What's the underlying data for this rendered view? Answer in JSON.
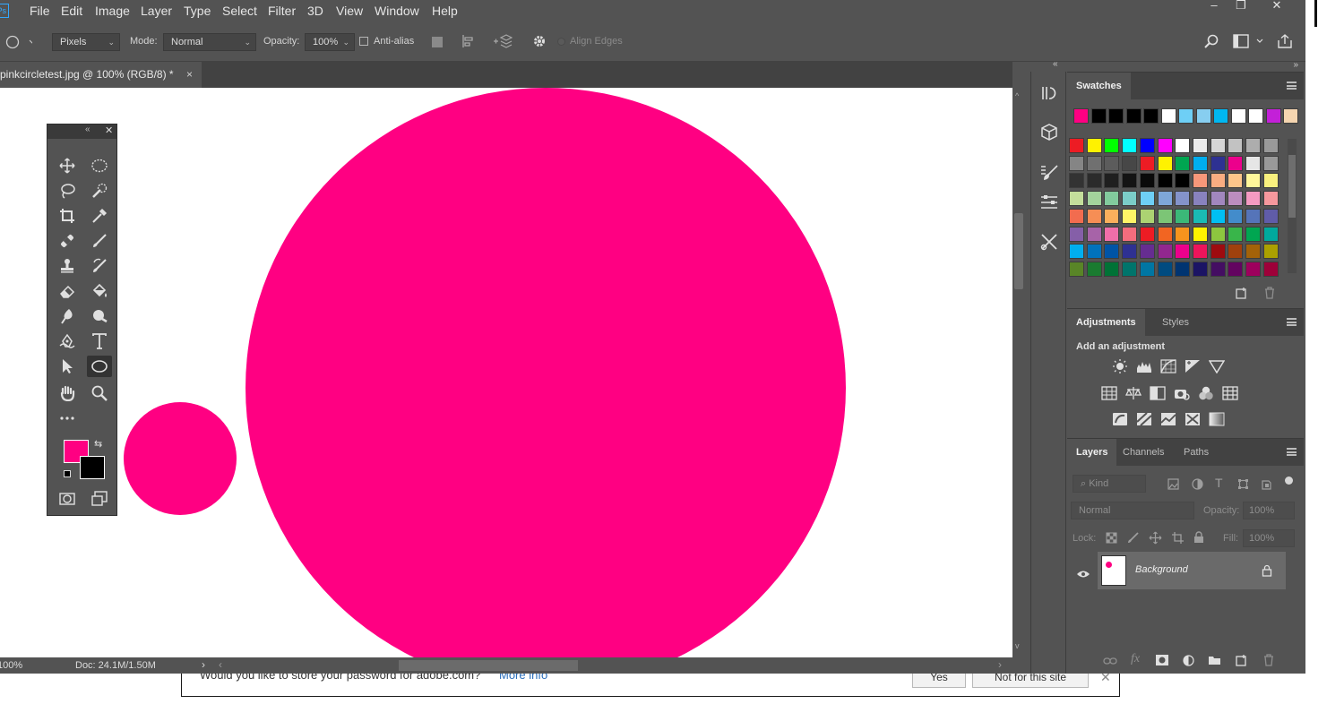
{
  "app": {
    "logo": "Ps"
  },
  "menu": [
    "File",
    "Edit",
    "Image",
    "Layer",
    "Type",
    "Select",
    "Filter",
    "3D",
    "View",
    "Window",
    "Help"
  ],
  "window_controls": [
    "–",
    "❐",
    "✕"
  ],
  "options": {
    "tool_mode": "Pixels",
    "mode_label": "Mode:",
    "mode_value": "Normal",
    "opacity_label": "Opacity:",
    "opacity_value": "100%",
    "antialias_label": "Anti-alias",
    "align_edges_label": "Align Edges"
  },
  "document": {
    "tab_title": "pinkcircletest.jpg @ 100% (RGB/8) *",
    "tab_close": "×",
    "zoom": "100%",
    "doc_info": "Doc: 24.1M/1.50M",
    "circle_color": "#ff0082",
    "foreground_color": "#ff0082",
    "background_color": "#000000"
  },
  "panels": {
    "swatches_tab": "Swatches",
    "adjustments_tab": "Adjustments",
    "styles_tab": "Styles",
    "adjustments_heading": "Add an adjustment",
    "layers_tab": "Layers",
    "channels_tab": "Channels",
    "paths_tab": "Paths",
    "kind_filter": "Kind",
    "blend_mode": "Normal",
    "opacity_label": "Opacity:",
    "opacity_value": "100%",
    "lock_label": "Lock:",
    "fill_label": "Fill:",
    "fill_value": "100%",
    "layer_name": "Background"
  },
  "swatches": {
    "recent": [
      "#ff0082",
      "#000000",
      "#000000",
      "#000000",
      "#000000",
      "#ffffff",
      "#6ecff6",
      "#87cef0",
      "#00b7f1",
      "#ffffff",
      "#ffffff",
      "#c320d8",
      "#f5d5b0"
    ],
    "grid": [
      [
        "#ed1c24",
        "#fff200",
        "#00ff00",
        "#00ffff",
        "#0000ff",
        "#ff00ff",
        "#ffffff",
        "#ebebeb",
        "#d6d6d6",
        "#c2c2c2",
        "#adadad",
        "#999999"
      ],
      [
        "#858585",
        "#707070",
        "#5c5c5c",
        "#474747",
        "#ed1c24",
        "#fff200",
        "#00a651",
        "#00aeef",
        "#2e3192",
        "#ec008c",
        "#e6e6e6",
        "#999999"
      ],
      [
        "#333333",
        "#2b2b2b",
        "#1f1f1f",
        "#141414",
        "#0a0a0a",
        "#000000",
        "#000000",
        "#f7977a",
        "#f9ad81",
        "#fdc68a",
        "#fff79a",
        "#f9f07e"
      ],
      [
        "#c4df9b",
        "#a3d39c",
        "#82ca9d",
        "#7bcdc8",
        "#6ecff6",
        "#7ea7d8",
        "#8493ca",
        "#8882be",
        "#a187be",
        "#bc8dbf",
        "#f49ac2",
        "#f6989d"
      ],
      [
        "#f26c4f",
        "#f68e55",
        "#fbaf5c",
        "#fff467",
        "#acd372",
        "#7cc576",
        "#3bb878",
        "#1abbb4",
        "#00bff3",
        "#438ccb",
        "#5574b9",
        "#605ca8"
      ],
      [
        "#855fa8",
        "#a763a8",
        "#f06ea9",
        "#f26d7d",
        "#ed1c24",
        "#f26522",
        "#f7941d",
        "#fff200",
        "#8dc63f",
        "#39b54a",
        "#00a651",
        "#00a99d"
      ],
      [
        "#00aeef",
        "#0072bc",
        "#0054a6",
        "#2e3192",
        "#662d91",
        "#92278f",
        "#ec008c",
        "#ed145b",
        "#9e0b0f",
        "#a0410d",
        "#a36209",
        "#aba000"
      ],
      [
        "#598527",
        "#1a7b30",
        "#007236",
        "#00746b",
        "#0076a3",
        "#004b80",
        "#003471",
        "#1b1464",
        "#440e62",
        "#630460",
        "#9e005d",
        "#9e0039"
      ]
    ]
  }
}
